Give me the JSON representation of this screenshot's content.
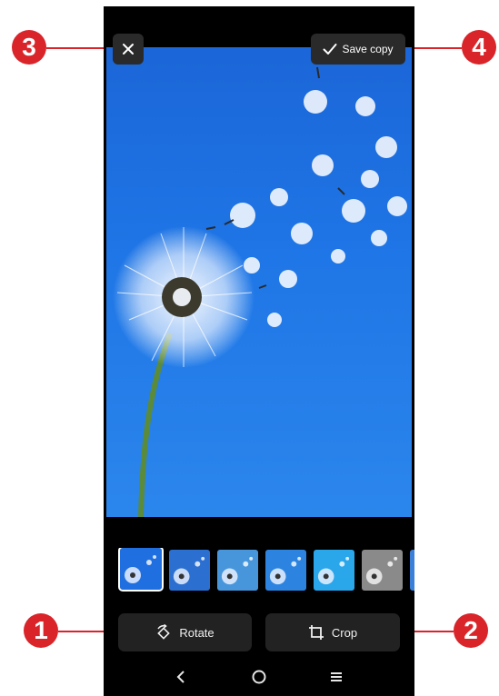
{
  "header": {
    "close_icon": "close-icon",
    "save_icon": "check-icon",
    "save_label": "Save copy"
  },
  "filters": [
    {
      "name": "original",
      "tint": "#1f6fe0",
      "selected": true
    },
    {
      "name": "filter-2",
      "tint": "#2b6fd0",
      "selected": false
    },
    {
      "name": "filter-3",
      "tint": "#4796dc",
      "selected": false
    },
    {
      "name": "filter-4",
      "tint": "#2d84e0",
      "selected": false
    },
    {
      "name": "filter-5",
      "tint": "#2aa6ea",
      "selected": false
    },
    {
      "name": "filter-6",
      "tint": "#8a8a8a",
      "selected": false
    },
    {
      "name": "filter-7",
      "tint": "#3a7fd8",
      "selected": false
    }
  ],
  "toolbar": {
    "rotate_label": "Rotate",
    "rotate_icon": "rotate-icon",
    "crop_label": "Crop",
    "crop_icon": "crop-icon"
  },
  "nav": {
    "back_icon": "back-icon",
    "home_icon": "home-icon",
    "recents_icon": "menu-icon"
  },
  "callouts": {
    "c1": "1",
    "c2": "2",
    "c3": "3",
    "c4": "4"
  },
  "colors": {
    "callout": "#d9242a",
    "sky": "#1f6fe0",
    "button_bg": "#222222"
  }
}
